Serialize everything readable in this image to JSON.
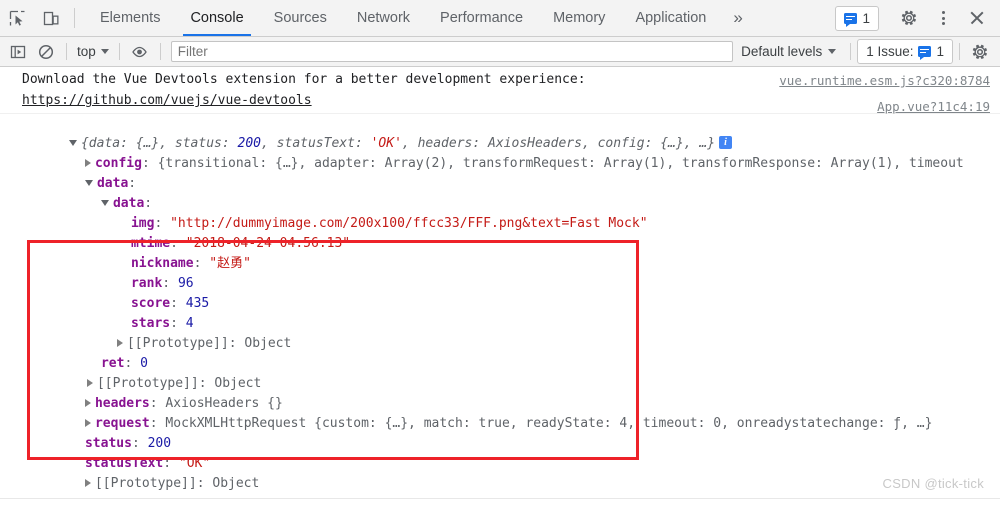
{
  "tabbar": {
    "inspect_icon": "inspect-cursor-icon",
    "device_icon": "device-toolbar-icon",
    "tabs": [
      {
        "label": "Elements",
        "selected": false
      },
      {
        "label": "Console",
        "selected": true
      },
      {
        "label": "Sources",
        "selected": false
      },
      {
        "label": "Network",
        "selected": false
      },
      {
        "label": "Performance",
        "selected": false
      },
      {
        "label": "Memory",
        "selected": false
      },
      {
        "label": "Application",
        "selected": false
      }
    ],
    "more_tabs_label": "»",
    "issues_count": "1",
    "settings_icon": "gear-icon",
    "more_icon": "kebab-menu-icon",
    "close_icon": "close-icon"
  },
  "console_toolbar": {
    "sidebar_icon": "console-sidebar-icon",
    "clear_icon": "clear-console-icon",
    "context_label": "top",
    "eye_icon": "live-expression-eye-icon",
    "filter_placeholder": "Filter",
    "filter_value": "",
    "levels_label": "Default levels",
    "issues_label": "1 Issue:",
    "issues_count": "1",
    "settings_icon": "console-settings-gear-icon"
  },
  "messages": {
    "vue_devtools": {
      "text": "Download the Vue Devtools extension for a better development experience:",
      "link": "https://github.com/vuejs/vue-devtools",
      "source": "vue.runtime.esm.js?c320:8784"
    },
    "object_log": {
      "source": "App.vue?11c4:19",
      "summary": {
        "prefix": "{",
        "parts": [
          {
            "key": "data",
            "value": "{…}"
          },
          {
            "key": "status",
            "value": "200"
          },
          {
            "key": "statusText",
            "value": "'OK'"
          },
          {
            "key": "headers",
            "value": "AxiosHeaders"
          },
          {
            "key": "config",
            "value": "{…}"
          }
        ],
        "ellipsis": "…",
        "suffix": "}"
      },
      "config_line": {
        "key": "config",
        "value": "{transitional: {…}, adapter: Array(2), transformRequest: Array(1), transformResponse: Array(1), timeout"
      },
      "data_key": "data",
      "inner_data_key": "data",
      "fields": [
        {
          "key": "img",
          "value": "\"http://dummyimage.com/200x100/ffcc33/FFF.png&text=Fast Mock\"",
          "type": "string"
        },
        {
          "key": "mtime",
          "value": "\"2018-04-24 04:56:13\"",
          "type": "string"
        },
        {
          "key": "nickname",
          "value": "\"赵勇\"",
          "type": "string"
        },
        {
          "key": "rank",
          "value": "96",
          "type": "number"
        },
        {
          "key": "score",
          "value": "435",
          "type": "number"
        },
        {
          "key": "stars",
          "value": "4",
          "type": "number"
        }
      ],
      "inner_prototype": "[[Prototype]]: Object",
      "ret_key": "ret",
      "ret_value": "0",
      "data_prototype": "[[Prototype]]: Object",
      "headers_key": "headers",
      "headers_value": "AxiosHeaders {}",
      "request_key": "request",
      "request_value": "MockXMLHttpRequest {custom: {…}, match: true, readyState: 4, timeout: 0, onreadystatechange: ƒ, …}",
      "status_key": "status",
      "status_value": "200",
      "statustext_key": "statusText",
      "statustext_value": "\"OK\"",
      "root_prototype": "[[Prototype]]: Object"
    }
  },
  "watermark": "CSDN @tick-tick",
  "colors": {
    "accent": "#1a73e8",
    "key": "#881391",
    "string": "#c41a16",
    "number": "#1a1aa6",
    "annotation_box": "#ee2229"
  }
}
